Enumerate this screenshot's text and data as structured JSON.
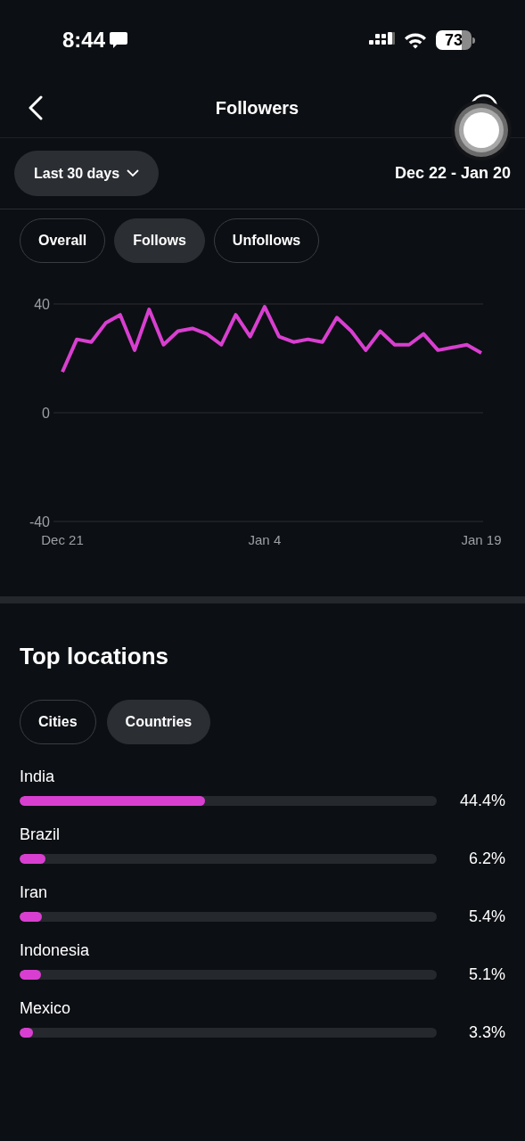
{
  "status_bar": {
    "time": "8:44",
    "battery": "73"
  },
  "header": {
    "title": "Followers"
  },
  "filter": {
    "period": "Last 30 days",
    "range": "Dec 22 - Jan 20"
  },
  "tabs": [
    {
      "label": "Overall",
      "selected": false
    },
    {
      "label": "Follows",
      "selected": true
    },
    {
      "label": "Unfollows",
      "selected": false
    }
  ],
  "chart_data": {
    "type": "line",
    "categories": [
      "Dec 21",
      null,
      null,
      null,
      null,
      null,
      null,
      null,
      null,
      null,
      null,
      null,
      null,
      null,
      "Jan 4",
      null,
      null,
      null,
      null,
      null,
      null,
      null,
      null,
      null,
      null,
      null,
      null,
      null,
      null,
      "Jan 19"
    ],
    "series": [
      {
        "color": "#d83fd0",
        "values": [
          15,
          27,
          26,
          33,
          36,
          23,
          38,
          25,
          30,
          31,
          29,
          25,
          36,
          28,
          39,
          28,
          26,
          27,
          26,
          35,
          30,
          23,
          30,
          25,
          25,
          29,
          23,
          24,
          25,
          22
        ]
      }
    ],
    "ylim": [
      -40,
      40
    ],
    "yticks": [
      -40,
      0,
      40
    ]
  },
  "top_locations": {
    "title": "Top locations",
    "tabs": [
      {
        "label": "Cities",
        "selected": false
      },
      {
        "label": "Countries",
        "selected": true
      }
    ],
    "rows": [
      {
        "name": "India",
        "level": 0.444,
        "reading": "44.4%"
      },
      {
        "name": "Brazil",
        "level": 0.062,
        "reading": "6.2%"
      },
      {
        "name": "Iran",
        "level": 0.054,
        "reading": "5.4%"
      },
      {
        "name": "Indonesia",
        "level": 0.051,
        "reading": "5.1%"
      },
      {
        "name": "Mexico",
        "level": 0.033,
        "reading": "3.3%"
      }
    ]
  }
}
